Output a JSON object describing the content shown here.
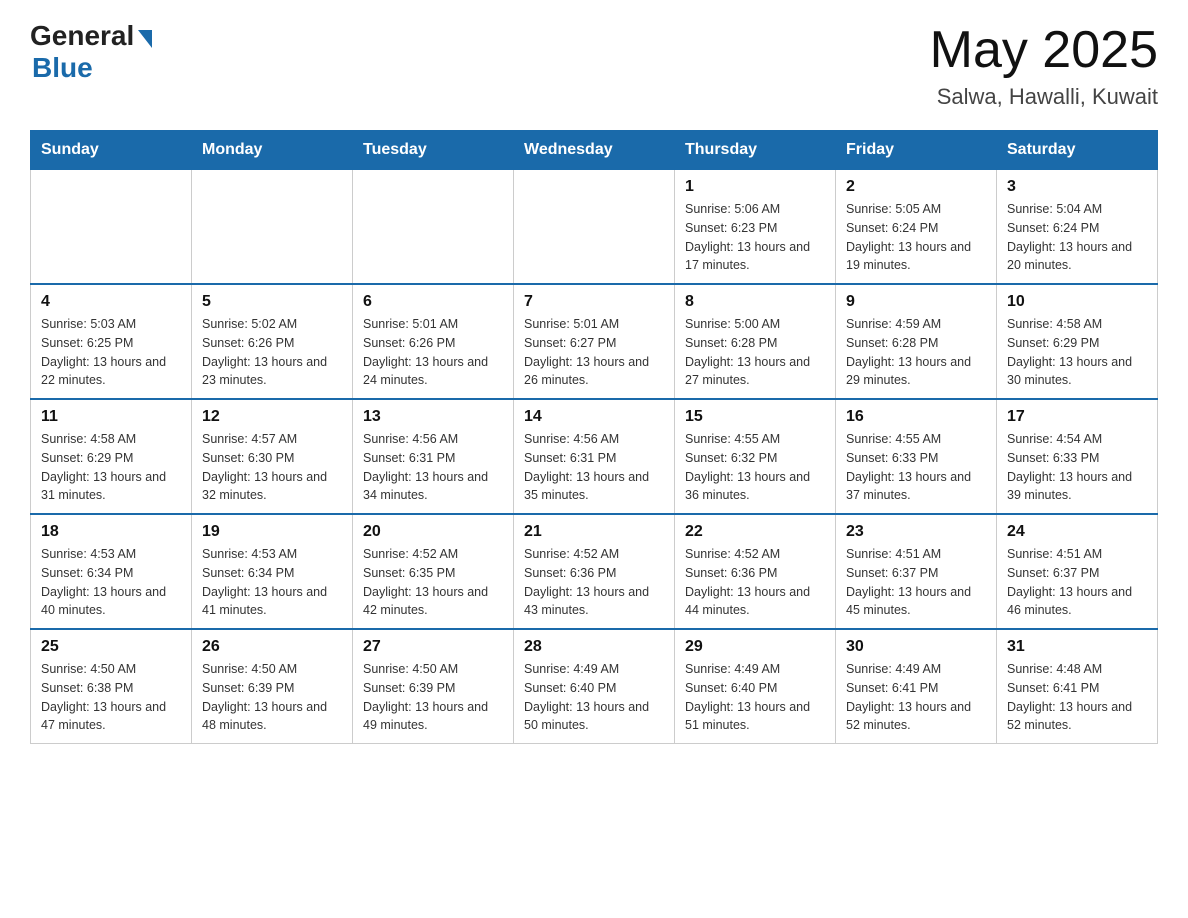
{
  "header": {
    "logo_general": "General",
    "logo_blue": "Blue",
    "month_year": "May 2025",
    "location": "Salwa, Hawalli, Kuwait"
  },
  "days_of_week": [
    "Sunday",
    "Monday",
    "Tuesday",
    "Wednesday",
    "Thursday",
    "Friday",
    "Saturday"
  ],
  "weeks": [
    [
      {
        "day": "",
        "info": ""
      },
      {
        "day": "",
        "info": ""
      },
      {
        "day": "",
        "info": ""
      },
      {
        "day": "",
        "info": ""
      },
      {
        "day": "1",
        "info": "Sunrise: 5:06 AM\nSunset: 6:23 PM\nDaylight: 13 hours and 17 minutes."
      },
      {
        "day": "2",
        "info": "Sunrise: 5:05 AM\nSunset: 6:24 PM\nDaylight: 13 hours and 19 minutes."
      },
      {
        "day": "3",
        "info": "Sunrise: 5:04 AM\nSunset: 6:24 PM\nDaylight: 13 hours and 20 minutes."
      }
    ],
    [
      {
        "day": "4",
        "info": "Sunrise: 5:03 AM\nSunset: 6:25 PM\nDaylight: 13 hours and 22 minutes."
      },
      {
        "day": "5",
        "info": "Sunrise: 5:02 AM\nSunset: 6:26 PM\nDaylight: 13 hours and 23 minutes."
      },
      {
        "day": "6",
        "info": "Sunrise: 5:01 AM\nSunset: 6:26 PM\nDaylight: 13 hours and 24 minutes."
      },
      {
        "day": "7",
        "info": "Sunrise: 5:01 AM\nSunset: 6:27 PM\nDaylight: 13 hours and 26 minutes."
      },
      {
        "day": "8",
        "info": "Sunrise: 5:00 AM\nSunset: 6:28 PM\nDaylight: 13 hours and 27 minutes."
      },
      {
        "day": "9",
        "info": "Sunrise: 4:59 AM\nSunset: 6:28 PM\nDaylight: 13 hours and 29 minutes."
      },
      {
        "day": "10",
        "info": "Sunrise: 4:58 AM\nSunset: 6:29 PM\nDaylight: 13 hours and 30 minutes."
      }
    ],
    [
      {
        "day": "11",
        "info": "Sunrise: 4:58 AM\nSunset: 6:29 PM\nDaylight: 13 hours and 31 minutes."
      },
      {
        "day": "12",
        "info": "Sunrise: 4:57 AM\nSunset: 6:30 PM\nDaylight: 13 hours and 32 minutes."
      },
      {
        "day": "13",
        "info": "Sunrise: 4:56 AM\nSunset: 6:31 PM\nDaylight: 13 hours and 34 minutes."
      },
      {
        "day": "14",
        "info": "Sunrise: 4:56 AM\nSunset: 6:31 PM\nDaylight: 13 hours and 35 minutes."
      },
      {
        "day": "15",
        "info": "Sunrise: 4:55 AM\nSunset: 6:32 PM\nDaylight: 13 hours and 36 minutes."
      },
      {
        "day": "16",
        "info": "Sunrise: 4:55 AM\nSunset: 6:33 PM\nDaylight: 13 hours and 37 minutes."
      },
      {
        "day": "17",
        "info": "Sunrise: 4:54 AM\nSunset: 6:33 PM\nDaylight: 13 hours and 39 minutes."
      }
    ],
    [
      {
        "day": "18",
        "info": "Sunrise: 4:53 AM\nSunset: 6:34 PM\nDaylight: 13 hours and 40 minutes."
      },
      {
        "day": "19",
        "info": "Sunrise: 4:53 AM\nSunset: 6:34 PM\nDaylight: 13 hours and 41 minutes."
      },
      {
        "day": "20",
        "info": "Sunrise: 4:52 AM\nSunset: 6:35 PM\nDaylight: 13 hours and 42 minutes."
      },
      {
        "day": "21",
        "info": "Sunrise: 4:52 AM\nSunset: 6:36 PM\nDaylight: 13 hours and 43 minutes."
      },
      {
        "day": "22",
        "info": "Sunrise: 4:52 AM\nSunset: 6:36 PM\nDaylight: 13 hours and 44 minutes."
      },
      {
        "day": "23",
        "info": "Sunrise: 4:51 AM\nSunset: 6:37 PM\nDaylight: 13 hours and 45 minutes."
      },
      {
        "day": "24",
        "info": "Sunrise: 4:51 AM\nSunset: 6:37 PM\nDaylight: 13 hours and 46 minutes."
      }
    ],
    [
      {
        "day": "25",
        "info": "Sunrise: 4:50 AM\nSunset: 6:38 PM\nDaylight: 13 hours and 47 minutes."
      },
      {
        "day": "26",
        "info": "Sunrise: 4:50 AM\nSunset: 6:39 PM\nDaylight: 13 hours and 48 minutes."
      },
      {
        "day": "27",
        "info": "Sunrise: 4:50 AM\nSunset: 6:39 PM\nDaylight: 13 hours and 49 minutes."
      },
      {
        "day": "28",
        "info": "Sunrise: 4:49 AM\nSunset: 6:40 PM\nDaylight: 13 hours and 50 minutes."
      },
      {
        "day": "29",
        "info": "Sunrise: 4:49 AM\nSunset: 6:40 PM\nDaylight: 13 hours and 51 minutes."
      },
      {
        "day": "30",
        "info": "Sunrise: 4:49 AM\nSunset: 6:41 PM\nDaylight: 13 hours and 52 minutes."
      },
      {
        "day": "31",
        "info": "Sunrise: 4:48 AM\nSunset: 6:41 PM\nDaylight: 13 hours and 52 minutes."
      }
    ]
  ]
}
